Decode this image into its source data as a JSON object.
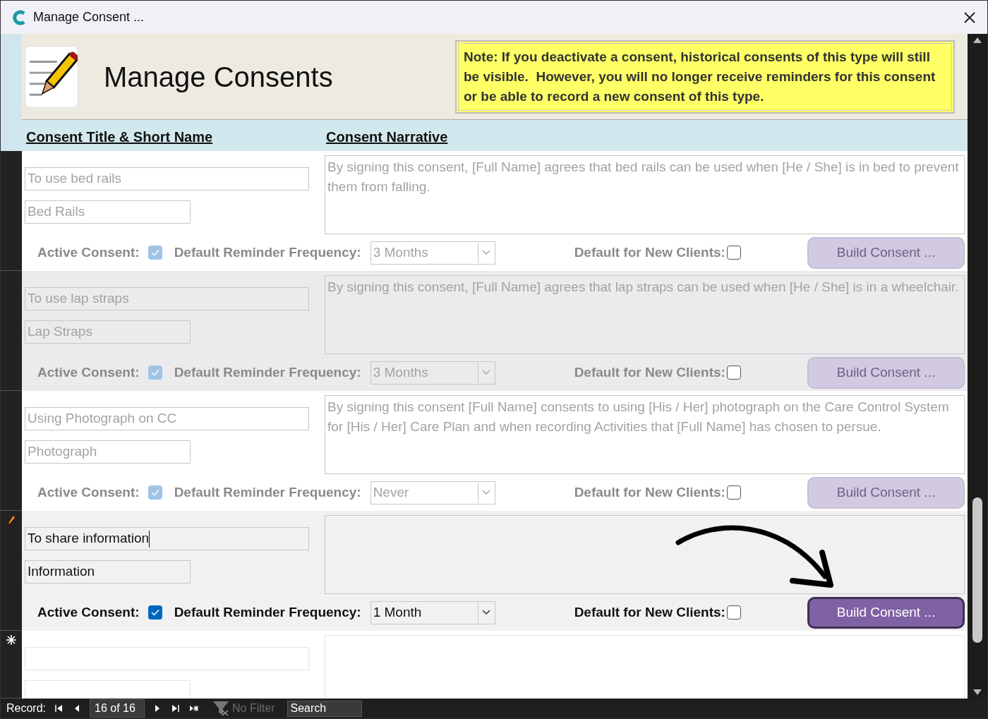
{
  "window": {
    "title": "Manage Consent ..."
  },
  "header": {
    "title": "Manage Consents",
    "note": "Note: If you deactivate a consent, historical consents of this type will still be visible.  However, you will no longer receive reminders for this consent or be able to record a new consent of this type."
  },
  "columns": [
    "Consent Title & Short Name",
    "Consent Narrative"
  ],
  "records": [
    {
      "kind": "record",
      "disabled": true,
      "title": "To use bed rails",
      "short_name": "Bed Rails",
      "narrative": "By signing this consent, [Full Name] agrees that bed rails can be used when [He / She] is in bed to prevent them from falling.",
      "active_label": "Active Consent:",
      "active": true,
      "frequency_label": "Default Reminder Frequency:",
      "frequency": "3 Months",
      "default_label": "Default for New Clients:",
      "default_new": false,
      "button": "Build Consent ..."
    },
    {
      "kind": "record",
      "disabled": true,
      "title": "To use lap straps",
      "short_name": "Lap Straps",
      "narrative": "By signing this consent, [Full Name] agrees that lap straps can be used when [He / She] is in a wheelchair.",
      "active_label": "Active Consent:",
      "active": true,
      "frequency_label": "Default Reminder Frequency:",
      "frequency": "3 Months",
      "default_label": "Default for New Clients:",
      "default_new": false,
      "button": "Build Consent ..."
    },
    {
      "kind": "record",
      "disabled": true,
      "title": "Using Photograph on CC",
      "short_name": "Photograph",
      "narrative": "By signing this consent [Full Name] consents to using [His / Her] photograph on the Care Control System for [His / Her] Care Plan and when recording Activities that [Full Name]  has chosen to persue.",
      "active_label": "Active Consent:",
      "active": true,
      "frequency_label": "Default Reminder Frequency:",
      "frequency": "Never",
      "default_label": "Default for New Clients:",
      "default_new": false,
      "button": "Build Consent ..."
    },
    {
      "kind": "editing",
      "disabled": false,
      "title": "To share information",
      "short_name": "Information",
      "active_label": "Active Consent:",
      "active": true,
      "frequency_label": "Default Reminder Frequency:",
      "frequency": "1 Month",
      "default_label": "Default for New Clients:",
      "default_new": false,
      "button": "Build Consent ..."
    },
    {
      "kind": "new"
    }
  ],
  "status_bar": {
    "label": "Record:",
    "position": "16 of 16",
    "filter": "No Filter",
    "search_placeholder": "Search"
  }
}
